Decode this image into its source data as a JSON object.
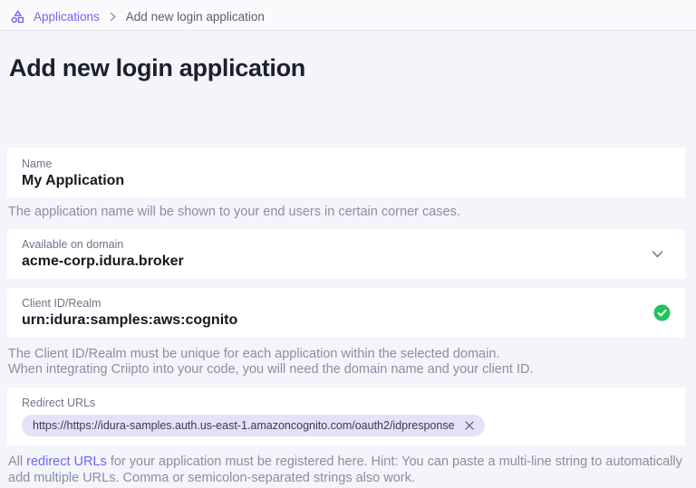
{
  "breadcrumb": {
    "applications_label": "Applications",
    "current_label": "Add new login application"
  },
  "page": {
    "title": "Add new login application"
  },
  "form": {
    "name": {
      "label": "Name",
      "value": "My Application",
      "help": "The application name will be shown to your end users in certain corner cases."
    },
    "domain": {
      "label": "Available on domain",
      "value": "acme-corp.idura.broker"
    },
    "client_id": {
      "label": "Client ID/Realm",
      "value": "urn:idura:samples:aws:cognito",
      "help_line1": "The Client ID/Realm must be unique for each application within the selected domain.",
      "help_line2": "When integrating Criipto into your code, you will need the domain name and your client ID."
    },
    "redirect_urls": {
      "label": "Redirect URLs",
      "chips": [
        {
          "value": "https://https://idura-samples.auth.us-east-1.amazoncognito.com/oauth2/idpresponse"
        }
      ],
      "help_prefix": "All ",
      "help_link": "redirect URLs",
      "help_suffix": " for your application must be registered here. Hint: You can paste a multi-line string to automatically add multiple URLs. Comma or semicolon-separated strings also work."
    }
  },
  "icons": {
    "breadcrumb_app": "shapes-icon",
    "separator": "chevron-right-icon",
    "domain_dropdown": "chevron-down-icon",
    "client_id_status": "check-circle-icon",
    "chip_remove": "close-icon"
  },
  "colors": {
    "accent": "#7266ef",
    "success": "#1fc45c",
    "page-bg": "#f4f4fb",
    "card-bg": "#ffffff",
    "chip-bg": "#e4e1f8",
    "heading": "#1d1f2a",
    "label": "#70738a",
    "value": "#17181f",
    "help": "#8b8ea1"
  }
}
